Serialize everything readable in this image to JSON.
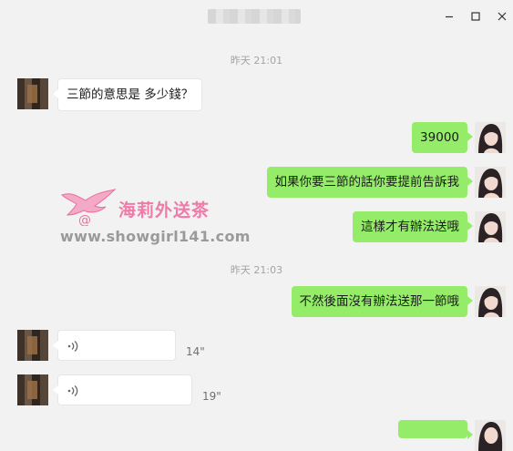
{
  "window": {
    "title": "████████",
    "minimize_icon": "minimize-icon",
    "maximize_icon": "maximize-icon",
    "close_icon": "close-icon"
  },
  "timestamps": [
    "昨天 21:01",
    "昨天 21:03"
  ],
  "watermark": {
    "brand": "海莉外送茶",
    "url": "www.showgirl141.com",
    "logo_icon": "bird-logo-icon",
    "color": "#f07aa8"
  },
  "colors": {
    "background": "#f2f2f2",
    "outgoing_bubble": "#95ec69",
    "incoming_bubble": "#ffffff"
  },
  "messages": [
    {
      "side": "incoming",
      "text": "三節的意思是 多少錢？"
    },
    {
      "side": "outgoing",
      "text": "39000"
    },
    {
      "side": "outgoing",
      "text": "如果你要三節的話你要提前告訴我"
    },
    {
      "side": "outgoing",
      "text": "這樣才有辦法送哦"
    },
    {
      "side": "outgoing",
      "text": "不然後面沒有辦法送那一節哦"
    }
  ],
  "voice_messages": [
    {
      "side": "incoming",
      "duration": "14\"",
      "icon": "voice-wave-icon"
    },
    {
      "side": "incoming",
      "duration": "19\"",
      "icon": "voice-wave-icon"
    }
  ]
}
